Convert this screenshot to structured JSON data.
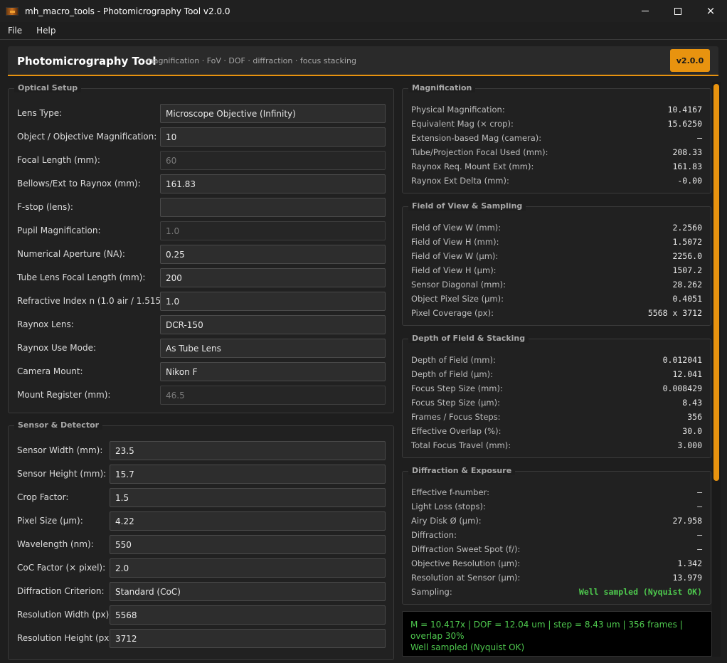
{
  "window": {
    "title": "mh_macro_tools - Photomicrography Tool  v2.0.0",
    "icon": "app-logo-icon",
    "controls": {
      "minimize": "minimize-icon",
      "maximize": "maximize-icon",
      "close": "×"
    }
  },
  "menu": [
    {
      "label": "File"
    },
    {
      "label": "Help"
    }
  ],
  "header": {
    "title": "Photomicrography Tool",
    "subtitle": "magnification · FoV · DOF · diffraction · focus stacking",
    "version": "v2.0.0"
  },
  "colors": {
    "accent": "#e8930f",
    "ok": "#4ec94e",
    "background": "#1e1e1e"
  },
  "optical_setup": {
    "title": "Optical Setup",
    "fields": [
      {
        "label": "Lens Type:",
        "value": "Microscope Objective (Infinity)",
        "disabled": false,
        "kind": "combo"
      },
      {
        "label": "Object / Objective Magnification:",
        "value": "10",
        "disabled": false
      },
      {
        "label": "Focal Length (mm):",
        "value": "60",
        "disabled": true
      },
      {
        "label": "Bellows/Ext to Raynox (mm):",
        "value": "161.83",
        "disabled": false
      },
      {
        "label": "F-stop (lens):",
        "value": "",
        "disabled": false
      },
      {
        "label": "Pupil Magnification:",
        "value": "1.0",
        "disabled": true
      },
      {
        "label": "Numerical Aperture (NA):",
        "value": "0.25",
        "disabled": false
      },
      {
        "label": "Tube Lens Focal Length (mm):",
        "value": "200",
        "disabled": false
      },
      {
        "label": "Refractive Index n (1.0 air / 1.515 oil):",
        "value": "1.0",
        "disabled": false
      },
      {
        "label": "Raynox Lens:",
        "value": "DCR-150",
        "disabled": false,
        "kind": "combo"
      },
      {
        "label": "Raynox Use Mode:",
        "value": "As Tube Lens",
        "disabled": false,
        "kind": "combo"
      },
      {
        "label": "Camera Mount:",
        "value": "Nikon F",
        "disabled": false,
        "kind": "combo"
      },
      {
        "label": "Mount Register (mm):",
        "value": "46.5",
        "disabled": true
      }
    ]
  },
  "sensor": {
    "title": "Sensor & Detector",
    "fields": [
      {
        "label": "Sensor Width (mm):",
        "value": "23.5"
      },
      {
        "label": "Sensor Height (mm):",
        "value": "15.7"
      },
      {
        "label": "Crop Factor:",
        "value": "1.5"
      },
      {
        "label": "Pixel Size (µm):",
        "value": "4.22"
      },
      {
        "label": "Wavelength (nm):",
        "value": "550"
      },
      {
        "label": "CoC Factor (× pixel):",
        "value": "2.0"
      },
      {
        "label": "Diffraction Criterion:",
        "value": "Standard (CoC)",
        "kind": "combo"
      },
      {
        "label": "Resolution Width (px):",
        "value": "5568"
      },
      {
        "label": "Resolution Height (px):",
        "value": "3712"
      }
    ]
  },
  "magnification": {
    "title": "Magnification",
    "rows": [
      {
        "label": "Physical Magnification:",
        "value": "10.4167"
      },
      {
        "label": "Equivalent Mag (× crop):",
        "value": "15.6250"
      },
      {
        "label": "Extension-based Mag (camera):",
        "value": "–"
      },
      {
        "label": "Tube/Projection Focal Used (mm):",
        "value": "208.33"
      },
      {
        "label": "Raynox Req. Mount Ext (mm):",
        "value": "161.83"
      },
      {
        "label": "Raynox Ext Delta (mm):",
        "value": "-0.00"
      }
    ]
  },
  "fov": {
    "title": "Field of View & Sampling",
    "rows": [
      {
        "label": "Field of View W (mm):",
        "value": "2.2560"
      },
      {
        "label": "Field of View H (mm):",
        "value": "1.5072"
      },
      {
        "label": "Field of View W (µm):",
        "value": "2256.0"
      },
      {
        "label": "Field of View H (µm):",
        "value": "1507.2"
      },
      {
        "label": "Sensor Diagonal (mm):",
        "value": "28.262"
      },
      {
        "label": "Object Pixel Size (µm):",
        "value": "0.4051"
      },
      {
        "label": "Pixel Coverage (px):",
        "value": "5568 x 3712"
      }
    ]
  },
  "dof": {
    "title": "Depth of Field & Stacking",
    "rows": [
      {
        "label": "Depth of Field (mm):",
        "value": "0.012041"
      },
      {
        "label": "Depth of Field (µm):",
        "value": "12.041"
      },
      {
        "label": "Focus Step Size (mm):",
        "value": "0.008429"
      },
      {
        "label": "Focus Step Size (µm):",
        "value": "8.43"
      },
      {
        "label": "Frames / Focus Steps:",
        "value": "356"
      },
      {
        "label": "Effective Overlap (%):",
        "value": "30.0"
      },
      {
        "label": "Total Focus Travel (mm):",
        "value": "3.000"
      }
    ]
  },
  "diffraction": {
    "title": "Diffraction & Exposure",
    "rows": [
      {
        "label": "Effective f-number:",
        "value": "–"
      },
      {
        "label": "Light Loss (stops):",
        "value": "–"
      },
      {
        "label": "Airy Disk Ø (µm):",
        "value": "27.958"
      },
      {
        "label": "Diffraction:",
        "value": "–"
      },
      {
        "label": "Diffraction Sweet Spot (f/):",
        "value": "–"
      },
      {
        "label": "Objective Resolution (µm):",
        "value": "1.342"
      },
      {
        "label": "Resolution at Sensor (µm):",
        "value": "13.979"
      },
      {
        "label": "Sampling:",
        "value": "Well sampled (Nyquist OK)",
        "ok": true
      }
    ]
  },
  "status": {
    "line1": "M = 10.417x   |   DOF = 12.04 um   |   step = 8.43 um   |   356 frames   |   overlap 30%",
    "line2": "Well sampled (Nyquist OK)"
  }
}
